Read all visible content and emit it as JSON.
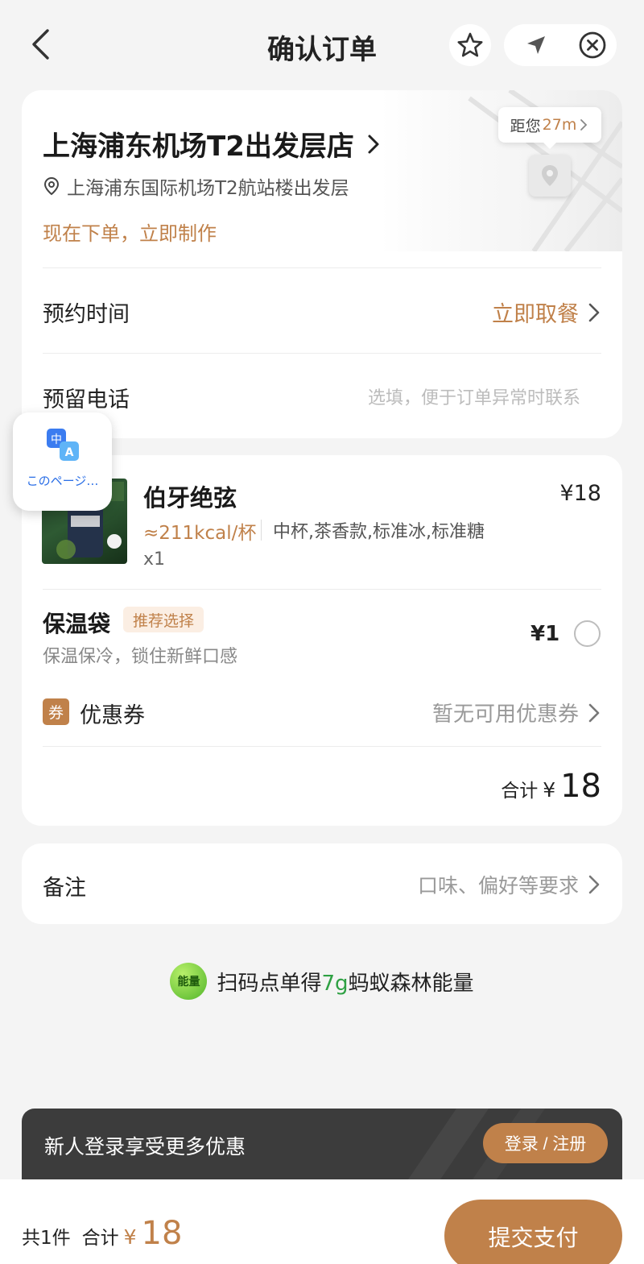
{
  "header": {
    "title": "确认订单",
    "icons": {
      "back": "chevron-left-icon",
      "favorite": "star-icon",
      "locate": "navigation-arrow-icon",
      "close": "close-circle-icon"
    }
  },
  "store": {
    "name": "上海浦东机场T2出发层店",
    "distance_prefix": "距您",
    "distance": "27m",
    "address": "上海浦东国际机场T2航站楼出发层",
    "notice": "现在下单，立即制作",
    "reservation_label": "预约时间",
    "reservation_value": "立即取餐",
    "phone_label": "预留电话",
    "phone_placeholder": "选填，便于订单异常时联系",
    "phone_value": ""
  },
  "order": {
    "product": {
      "name": "伯牙绝弦",
      "price": "¥18",
      "kcal": "≈211kcal/杯",
      "spec": "中杯,茶香款,标准冰,标准糖",
      "qty": "x1"
    },
    "addon": {
      "title": "保温袋",
      "badge": "推荐选择",
      "desc": "保温保冷，锁住新鲜口感",
      "price": "¥1",
      "selected": false
    },
    "coupon": {
      "icon_text": "券",
      "label": "优惠券",
      "value": "暂无可用优惠券"
    },
    "total": {
      "label": "合计",
      "currency": "¥",
      "amount": "18"
    }
  },
  "remark": {
    "label": "备注",
    "placeholder": "口味、偏好等要求"
  },
  "energy": {
    "badge": "能量",
    "text_before": "扫码点单得",
    "amount": "7g",
    "text_after": "蚂蚁森林能量"
  },
  "login_banner": {
    "text": "新人登录享受更多优惠",
    "button": "登录 / 注册"
  },
  "bottom_bar": {
    "count": "共1件",
    "total_label": "合计",
    "currency": "¥",
    "amount": "18",
    "submit": "提交支付"
  },
  "translate_widget": {
    "icon_text_1": "中",
    "icon_text_2": "A",
    "label": "このページ…"
  },
  "colors": {
    "accent": "#c0814a",
    "energy_green": "#2ea043",
    "banner_dark": "#3c3c3c",
    "translate_blue": "#2a6ee6"
  }
}
